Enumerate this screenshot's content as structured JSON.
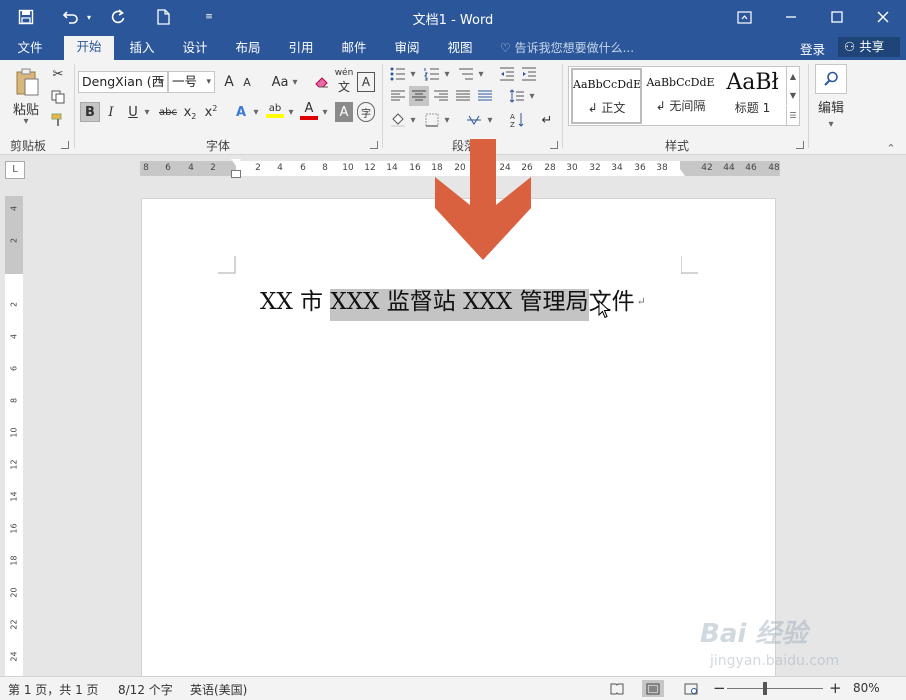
{
  "titlebar": {
    "title": "文档1 - Word"
  },
  "tabs": [
    "文件",
    "开始",
    "插入",
    "设计",
    "布局",
    "引用",
    "邮件",
    "审阅",
    "视图"
  ],
  "active_tab": "开始",
  "tell_me": "告诉我您想要做什么...",
  "login": "登录",
  "share": "共享",
  "clipboard": {
    "paste": "粘贴",
    "label": "剪贴板"
  },
  "font": {
    "name": "DengXian (西",
    "size": "一号",
    "label": "字体",
    "grow": "A",
    "shrink": "A",
    "case": "Aa",
    "phonetic": "wén",
    "phonetic_char": "文",
    "border_char": "A",
    "bold": "B",
    "italic": "I",
    "underline": "U",
    "strike": "abc",
    "sub": "x",
    "sup": "x",
    "effects": "A",
    "highlight": "ab",
    "color": "A",
    "shading": "A",
    "enclose": "字",
    "highlight_color": "#ffff00",
    "font_color": "#e00000"
  },
  "paragraph": {
    "label": "段落"
  },
  "styles": {
    "label": "样式",
    "items": [
      {
        "sample": "AaBbCcDdE",
        "name": "↲ 正文"
      },
      {
        "sample": "AaBbCcDdE",
        "name": "↲ 无间隔"
      },
      {
        "sample": "AaBł",
        "name": "标题 1"
      }
    ]
  },
  "editing": {
    "label": "编辑"
  },
  "ruler": {
    "corner": "L",
    "ticks": [
      "8",
      "6",
      "4",
      "2",
      "2",
      "4",
      "6",
      "8",
      "10",
      "12",
      "14",
      "16",
      "18",
      "20",
      "22",
      "24",
      "26",
      "28",
      "30",
      "32",
      "34",
      "36",
      "38",
      "42",
      "44",
      "46",
      "48"
    ],
    "vticks": [
      "4",
      "2",
      "",
      "2",
      "4",
      "6",
      "8",
      "10",
      "12",
      "14",
      "16",
      "18",
      "20",
      "22",
      "24"
    ]
  },
  "document": {
    "before": "XX 市 ",
    "selected": "XXX 监督站 XXX 管理局",
    "after": "文件",
    "para_mark": "↵"
  },
  "status": {
    "page": "第 1 页，共 1 页",
    "words": "8/12 个字",
    "language": "英语(美国)",
    "zoom_minus": "−",
    "zoom_plus": "+",
    "zoom": "80%",
    "zoom_fraction": 0.37
  },
  "watermark": {
    "brand": "Bai 经验",
    "sub": "jingyan.baidu.com"
  },
  "colors": {
    "word_blue": "#2b579a",
    "arrow": "#d9613f",
    "selection": "#c4c4c4"
  }
}
